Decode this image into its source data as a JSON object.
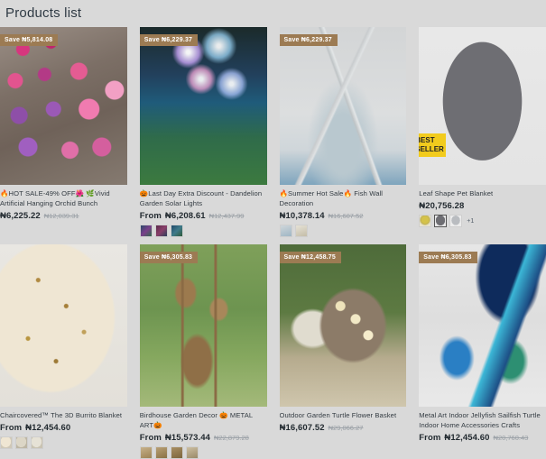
{
  "page": {
    "title": "Products list",
    "currency_symbol": "₦"
  },
  "labels": {
    "save_prefix": "Save",
    "from_prefix": "From",
    "best_seller": "BEST SELLER"
  },
  "products": [
    {
      "id": "orchid-bunch",
      "save_badge": "Save ₦5,814.08",
      "best_seller": false,
      "title": "🔥HOT SALE-49% OFF🌺 🌿Vivid Artificial Hanging Orchid Bunch",
      "price_prefix": "",
      "price": "₦6,225.22",
      "old_price": "₦12,039.31",
      "swatches": [],
      "more_count": ""
    },
    {
      "id": "dandelion-solar-lights",
      "save_badge": "Save ₦6,229.37",
      "best_seller": false,
      "title": "🎃Last Day Extra Discount - Dandelion Garden Solar Lights",
      "price_prefix": "From",
      "price": "₦6,208.61",
      "old_price": "₦12,437.99",
      "swatches": [
        "sw-a",
        "sw-b",
        "sw-c"
      ],
      "more_count": ""
    },
    {
      "id": "fish-wall-decoration",
      "save_badge": "Save ₦6,229.37",
      "best_seller": false,
      "title": "🔥Summer Hot Sale🔥 Fish Wall Decoration",
      "price_prefix": "",
      "price": "₦10,378.14",
      "old_price": "₦16,607.52",
      "swatches": [
        "sw-d",
        "sw-e"
      ],
      "more_count": ""
    },
    {
      "id": "leaf-shape-pet-blanket",
      "save_badge": "",
      "best_seller": true,
      "title": "Leaf Shape Pet Blanket",
      "price_prefix": "",
      "price": "₦20,756.28",
      "old_price": "",
      "swatches": [
        "sw-f",
        "sw-g",
        "sw-h"
      ],
      "more_count": "+1"
    },
    {
      "id": "burrito-blanket",
      "save_badge": "",
      "best_seller": false,
      "title": "Chaircovered™ The 3D Burrito Blanket",
      "price_prefix": "From",
      "price": "₦12,454.60",
      "old_price": "",
      "swatches": [
        "sw-i",
        "sw-j",
        "sw-k"
      ],
      "more_count": ""
    },
    {
      "id": "birdhouse-garden-decor",
      "save_badge": "Save ₦6,305.83",
      "best_seller": false,
      "title": "Birdhouse Garden Decor 🎃 METAL ART🎃",
      "price_prefix": "From",
      "price": "₦15,573.44",
      "old_price": "₦22,879.28",
      "swatches": [
        "sw-l",
        "sw-m",
        "sw-n",
        "sw-o"
      ],
      "more_count": ""
    },
    {
      "id": "turtle-flower-basket",
      "save_badge": "Save ₦12,458.75",
      "best_seller": false,
      "title": "Outdoor Garden Turtle Flower Basket",
      "price_prefix": "",
      "price": "₦16,607.52",
      "old_price": "₦29,066.27",
      "swatches": [],
      "more_count": ""
    },
    {
      "id": "metal-art-jellyfish-sailfish",
      "save_badge": "Save ₦6,305.83",
      "best_seller": false,
      "title": "Metal Art Indoor Jellyfish Sailfish Turtle Indoor Home Accessories Crafts",
      "price_prefix": "From",
      "price": "₦12,454.60",
      "old_price": "₦20,760.43",
      "swatches": [],
      "more_count": ""
    }
  ]
}
